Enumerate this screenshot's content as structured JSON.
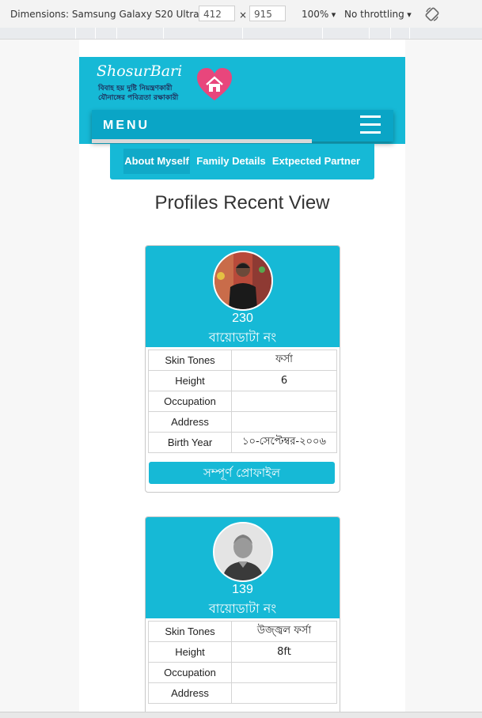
{
  "devtools": {
    "dimensions_label": "Dimensions: Samsung Galaxy S20 Ultra",
    "width": "412",
    "times": "×",
    "height": "915",
    "zoom": "100%",
    "throttling": "No throttling",
    "rotate_icon": "rotate-icon"
  },
  "brand": {
    "title": "ShosurBari",
    "tagline_1": "বিবাহ হয় দুষ্টি নিয়ন্ত্রণকারী",
    "tagline_2": "যৌনাঙ্গের পবিত্রতা রক্ষাকারী",
    "heart_color": "#e8467c"
  },
  "nav": {
    "menu_label": "MENU",
    "tabs": [
      {
        "label": "About Myself",
        "active": true
      },
      {
        "label": "Family Details",
        "active": false
      },
      {
        "label": "Extpected Partner",
        "active": false
      }
    ]
  },
  "page": {
    "title": "Profiles Recent View"
  },
  "colors": {
    "primary": "#16b9d6",
    "primary_dark": "#0aa5c6"
  },
  "profiles": [
    {
      "number": "230",
      "subtitle": "বায়োডাটা নং",
      "avatar": "photo-avatar",
      "rows": [
        {
          "label": "Skin Tones",
          "value": "ফর্সা"
        },
        {
          "label": "Height",
          "value": "6"
        },
        {
          "label": "Occupation",
          "value": ""
        },
        {
          "label": "Address",
          "value": ""
        },
        {
          "label": "Birth Year",
          "value": "১০-সেপ্টেম্বর-২০০৬"
        }
      ],
      "button": "সম্পূর্ণ প্রোফাইল"
    },
    {
      "number": "139",
      "subtitle": "বায়োডাটা নং",
      "avatar": "default-avatar",
      "rows": [
        {
          "label": "Skin Tones",
          "value": "উজ্জ্বল ফর্সা"
        },
        {
          "label": "Height",
          "value": "8ft"
        },
        {
          "label": "Occupation",
          "value": ""
        },
        {
          "label": "Address",
          "value": ""
        }
      ]
    }
  ]
}
